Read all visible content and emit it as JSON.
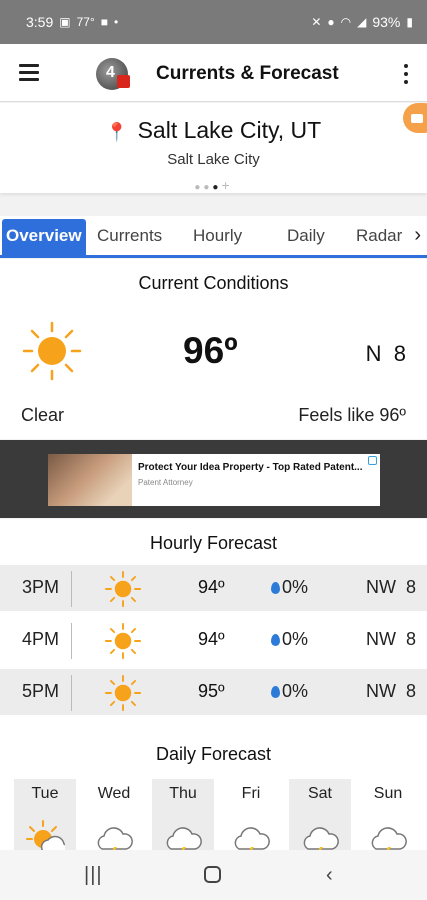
{
  "status_bar": {
    "time": "3:59",
    "temp": "77°",
    "dot": "•",
    "battery": "93%",
    "icons": [
      "image-icon",
      "video-icon",
      "mute-icon",
      "location-icon",
      "wifi-icon",
      "signal-icon",
      "battery-icon"
    ]
  },
  "app_bar": {
    "title": "Currents & Forecast",
    "logo_glyph": "4"
  },
  "location": {
    "name": "Salt Lake City, UT",
    "sub": "Salt Lake City",
    "page_count": 3,
    "active_page": 2
  },
  "tabs": [
    {
      "label": "Overview",
      "active": true
    },
    {
      "label": "Currents",
      "active": false
    },
    {
      "label": "Hourly",
      "active": false
    },
    {
      "label": "Daily",
      "active": false
    },
    {
      "label": "Radar",
      "active": false
    }
  ],
  "current": {
    "heading": "Current Conditions",
    "temp": "96º",
    "wind": "N  8",
    "condition": "Clear",
    "feels_like": "Feels like 96º",
    "icon": "sun-icon"
  },
  "ad": {
    "headline": "Protect Your Idea Property - Top Rated Patent...",
    "sub": "Patent Attorney"
  },
  "hourly": {
    "heading": "Hourly Forecast",
    "rows": [
      {
        "time": "3PM",
        "temp": "94º",
        "precip": "0%",
        "wind": "NW  8",
        "icon": "sun-icon"
      },
      {
        "time": "4PM",
        "temp": "94º",
        "precip": "0%",
        "wind": "NW  8",
        "icon": "sun-icon"
      },
      {
        "time": "5PM",
        "temp": "95º",
        "precip": "0%",
        "wind": "NW  8",
        "icon": "sun-icon"
      }
    ]
  },
  "daily": {
    "heading": "Daily Forecast",
    "days": [
      {
        "name": "Tue",
        "icon": "partly-cloudy-icon"
      },
      {
        "name": "Wed",
        "icon": "thunderstorm-icon"
      },
      {
        "name": "Thu",
        "icon": "thunderstorm-icon"
      },
      {
        "name": "Fri",
        "icon": "thunderstorm-icon"
      },
      {
        "name": "Sat",
        "icon": "thunderstorm-icon"
      },
      {
        "name": "Sun",
        "icon": "thunderstorm-icon"
      }
    ]
  },
  "colors": {
    "accent": "#2f6fdb",
    "sun": "#f7a21b",
    "drop": "#2c7bd9",
    "status_bar": "#7a7a7a"
  }
}
